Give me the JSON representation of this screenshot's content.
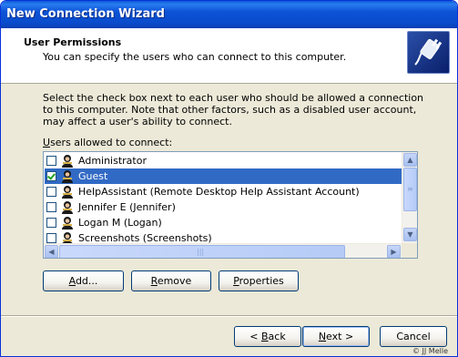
{
  "window": {
    "title": "New Connection Wizard"
  },
  "header": {
    "title": "User Permissions",
    "subtitle": "You can specify the users who can connect to this computer.",
    "icon": "connection-plug-icon"
  },
  "instructions": "Select the check box next to each user who should be allowed a connection to this computer.  Note that other factors, such as a disabled user account, may affect a user's ability to connect.",
  "users_label": {
    "mnemonic": "U",
    "rest": "sers allowed to connect:"
  },
  "users": [
    {
      "label": "Administrator",
      "checked": false,
      "selected": false
    },
    {
      "label": "Guest",
      "checked": true,
      "selected": true
    },
    {
      "label": "HelpAssistant (Remote Desktop Help Assistant Account)",
      "checked": false,
      "selected": false
    },
    {
      "label": "Jennifer E (Jennifer)",
      "checked": false,
      "selected": false
    },
    {
      "label": "Logan M (Logan)",
      "checked": false,
      "selected": false
    },
    {
      "label": "Screenshots (Screenshots)",
      "checked": false,
      "selected": false
    }
  ],
  "buttons": {
    "add": {
      "mnemonic": "A",
      "rest": "dd..."
    },
    "remove": {
      "mnemonic": "R",
      "rest": "emove"
    },
    "properties": {
      "mnemonic": "P",
      "rest": "roperties"
    },
    "back": {
      "prefix": "< ",
      "mnemonic": "B",
      "rest": "ack"
    },
    "next": {
      "mnemonic": "N",
      "rest": "ext >"
    },
    "cancel": "Cancel"
  },
  "credit": "© JJ Melle",
  "colors": {
    "selection": "#316ac5",
    "titlebar": "#0a4ccc",
    "dialog_bg": "#ece9d8"
  }
}
